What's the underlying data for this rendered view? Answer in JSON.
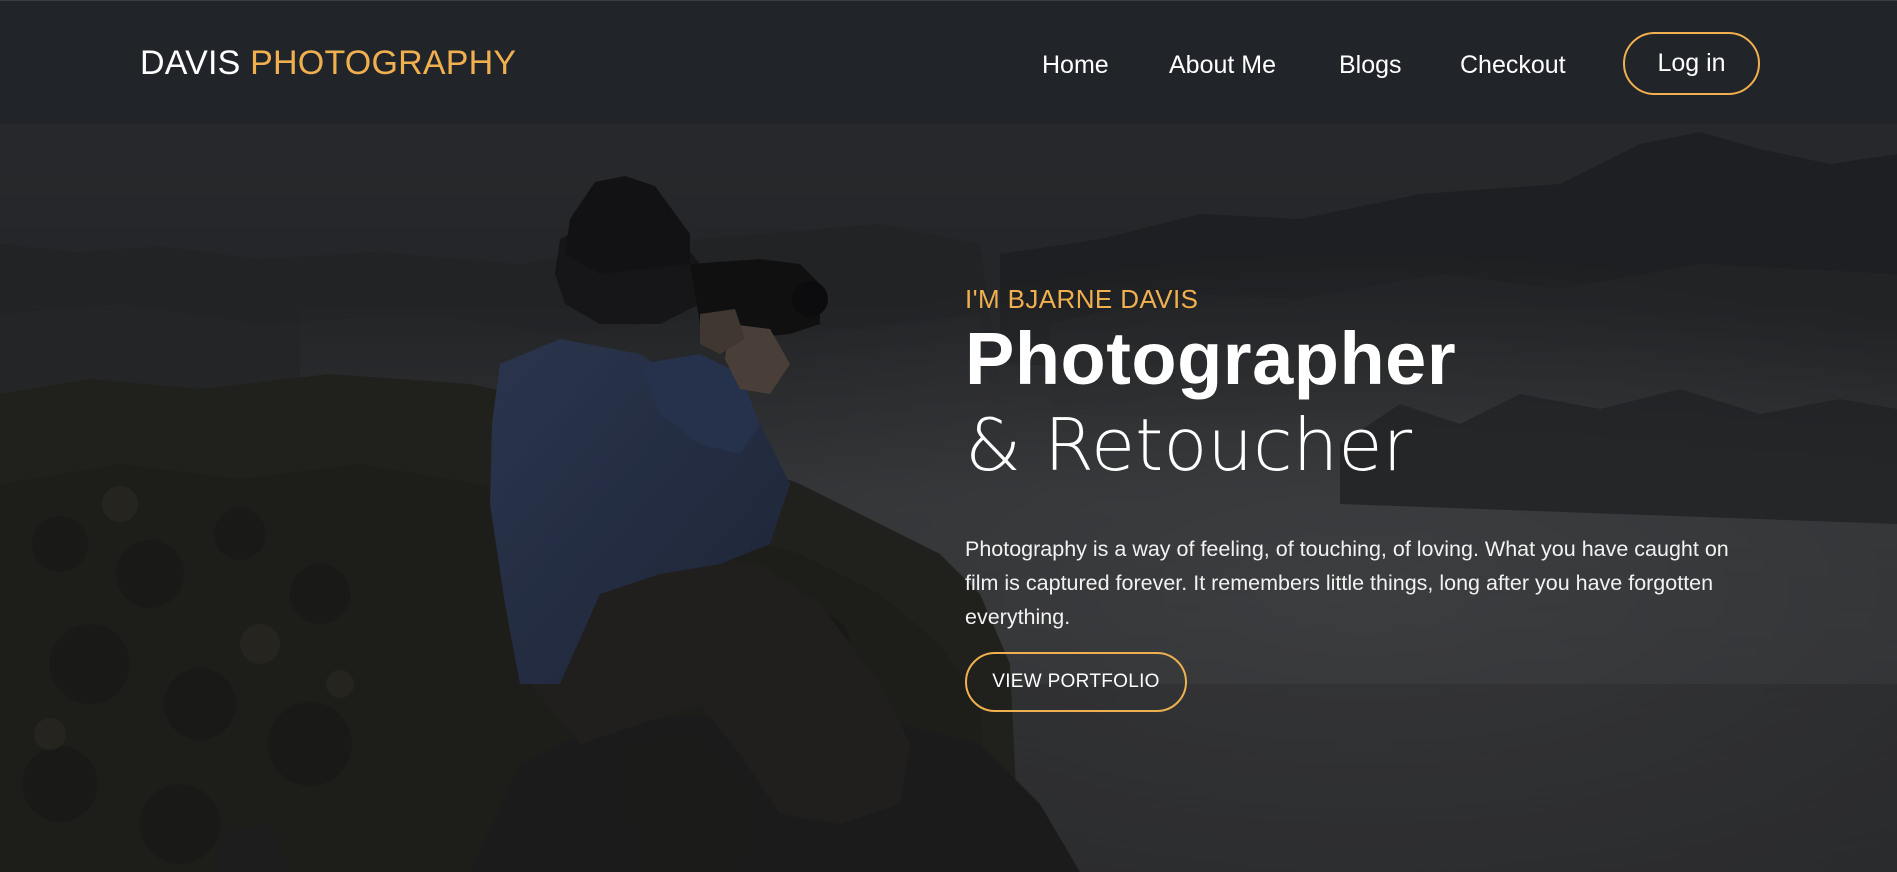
{
  "navbar": {
    "brand_first": "DAVIS",
    "brand_second": "PHOTOGRAPHY",
    "links": {
      "home": "Home",
      "about": "About Me",
      "blogs": "Blogs",
      "checkout": "Checkout"
    },
    "login_label": "Log in"
  },
  "hero": {
    "eyebrow": "I'M BJARNE DAVIS",
    "title": "Photographer",
    "subtitle": "& Retoucher",
    "blurb": "Photography is a way of feeling, of touching, of loving. What you have caught on film is captured forever. It remembers little things, long after you have forgotten everything.",
    "cta_label": "VIEW PORTFOLIO",
    "background": "photographer-on-mountain-photo"
  },
  "colors": {
    "accent": "#f0b04f",
    "navbar_bg": "#212429",
    "text": "#ffffff"
  }
}
